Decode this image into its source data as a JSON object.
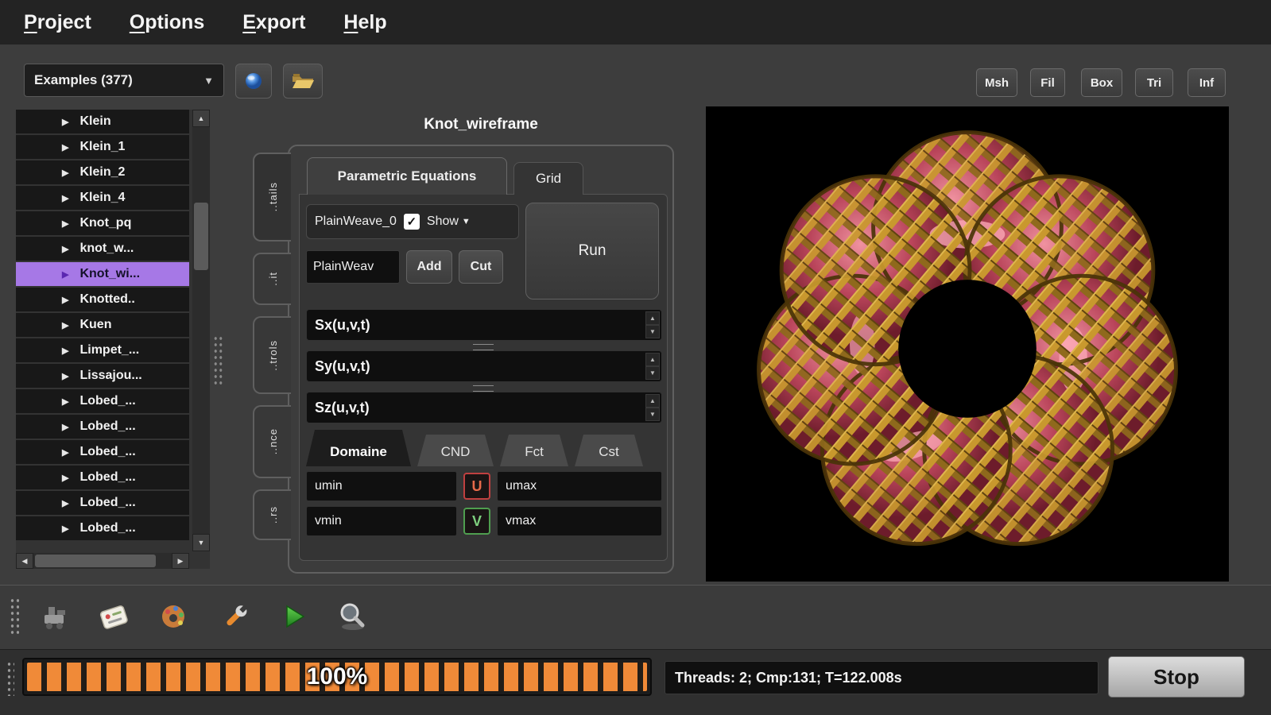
{
  "icons": {
    "triangle_right": "▶",
    "chevron_down": "▼",
    "arrow_up": "▲",
    "arrow_down": "▼",
    "arrow_left": "◀",
    "arrow_right": "▶",
    "check": "✓"
  },
  "menu": {
    "items": [
      "Project",
      "Options",
      "Export",
      "Help"
    ]
  },
  "topbar": {
    "examples_dropdown": "Examples (377)",
    "view_buttons": [
      "Msh",
      "Fil",
      "Box",
      "Tri",
      "Inf"
    ]
  },
  "sidebar": {
    "items": [
      "Klein",
      "Klein_1",
      "Klein_2",
      "Klein_4",
      "Knot_pq",
      "knot_w...",
      "Knot_wi...",
      "Knotted..",
      "Kuen",
      "Limpet_...",
      "Lissajou...",
      "Lobed_...",
      "Lobed_...",
      "Lobed_...",
      "Lobed_...",
      "Lobed_...",
      "Lobed_..."
    ],
    "selected_index": 6
  },
  "editor": {
    "title": "Knot_wireframe",
    "side_tabs": [
      "..tails",
      "..it",
      "..trols",
      "..nce",
      "..rs"
    ],
    "tabs": [
      "Parametric Equations",
      "Grid"
    ],
    "model_name": "PlainWeave_0",
    "show_label": "Show",
    "run_label": "Run",
    "name_field": "PlainWeav",
    "add_label": "Add",
    "cut_label": "Cut",
    "equations": [
      "Sx(u,v,t)",
      "Sy(u,v,t)",
      "Sz(u,v,t)"
    ],
    "sub_tabs": [
      "Domaine",
      "CND",
      "Fct",
      "Cst"
    ],
    "domain": {
      "umin": "umin",
      "u_badge": "U",
      "umax": "umax",
      "vmin": "vmin",
      "v_badge": "V",
      "vmax": "vmax"
    }
  },
  "statusbar": {
    "progress_text": "100%",
    "status_text": "Threads: 2; Cmp:131; T=122.008s",
    "stop_label": "Stop"
  }
}
